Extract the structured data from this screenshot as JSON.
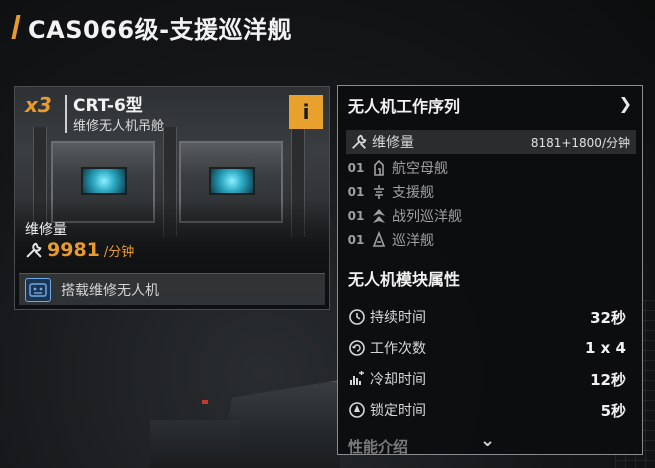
{
  "header": {
    "title": "CAS066级-支援巡洋舰"
  },
  "module_card": {
    "quantity": "x3",
    "name": "CRT-6型",
    "subtitle": "维修无人机吊舱",
    "info_label": "i",
    "stat_label": "维修量",
    "stat_value": "9981",
    "stat_unit": "/分钟",
    "tag_label": "搭载维修无人机"
  },
  "panel": {
    "title": "无人机工作序列",
    "chevron": "❯",
    "sequence": [
      {
        "lead": "",
        "icon": "wrench-icon",
        "label": "维修量",
        "value": "8181+1800/分钟",
        "active": true
      },
      {
        "lead": "01",
        "icon": "carrier-icon",
        "label": "航空母舰",
        "value": "",
        "active": false
      },
      {
        "lead": "01",
        "icon": "support-icon",
        "label": "支援舰",
        "value": "",
        "active": false
      },
      {
        "lead": "01",
        "icon": "battlecruiser-icon",
        "label": "战列巡洋舰",
        "value": "",
        "active": false
      },
      {
        "lead": "01",
        "icon": "cruiser-icon",
        "label": "巡洋舰",
        "value": "",
        "active": false
      }
    ],
    "attributes_title": "无人机模块属性",
    "attributes": [
      {
        "icon": "clock-icon",
        "label": "持续时间",
        "value": "32秒"
      },
      {
        "icon": "cycle-icon",
        "label": "工作次数",
        "value": "1 x 4"
      },
      {
        "icon": "cooldown-icon",
        "label": "冷却时间",
        "value": "12秒"
      },
      {
        "icon": "lock-target-icon",
        "label": "锁定时间",
        "value": "5秒"
      }
    ],
    "performance_title": "性能介绍",
    "scroll_icon": "⌄"
  },
  "colors": {
    "accent": "#e89a2c",
    "info_bg": "#e8a12c",
    "tag_border": "#6fa8e8"
  }
}
